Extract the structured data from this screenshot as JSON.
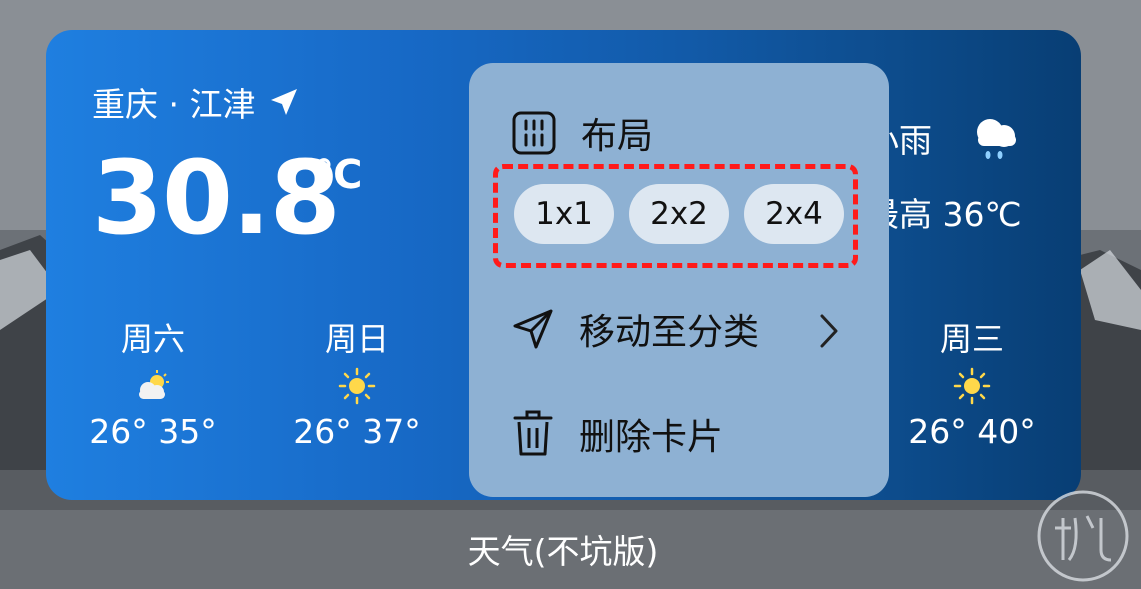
{
  "location": "重庆 · 江津",
  "temperature": "30.8",
  "unit": "℃",
  "condition_partial": "小雨",
  "high_partial": "最高 36℃",
  "forecast": [
    {
      "day": "周六",
      "icon": "partly-cloudy-icon",
      "range": "26° 35°"
    },
    {
      "day": "周日",
      "icon": "sun-icon",
      "range": "26° 37°"
    },
    {
      "day": "周三",
      "icon": "sun-icon",
      "range": "26° 40°"
    }
  ],
  "menu": {
    "layout_label": "布局",
    "sizes": [
      "1x1",
      "2x2",
      "2x4"
    ],
    "move_label": "移动至分类",
    "delete_label": "删除卡片"
  },
  "app_name": "天气(不坑版)",
  "colors": {
    "widget_start": "#1f7fe0",
    "widget_end": "#083e74",
    "menu_bg": "#8eb1d3",
    "highlight_border": "#ff1a1a"
  }
}
